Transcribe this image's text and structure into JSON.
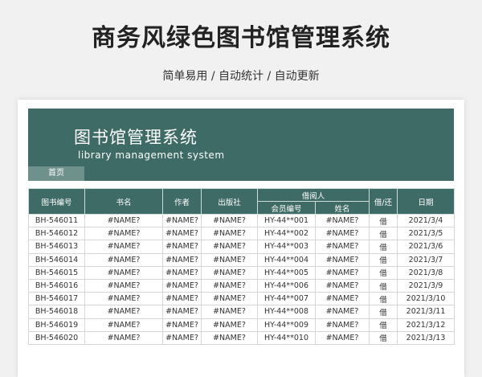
{
  "page": {
    "title": "商务风绿色图书馆管理系统",
    "subtitle": "简单易用 / 自动统计 / 自动更新"
  },
  "banner": {
    "title": "图书馆管理系统",
    "subtitle": "library management system",
    "home_tab": "首页"
  },
  "table": {
    "headers": {
      "book_no": "图书编号",
      "title": "书名",
      "author": "作者",
      "publisher": "出版社",
      "borrower": "借阅人",
      "member_no": "会员编号",
      "name": "姓名",
      "borrow_return": "借/还",
      "date": "日期"
    },
    "rows": [
      [
        "BH-546011",
        "#NAME?",
        "#NAME?",
        "#NAME?",
        "HY-44**001",
        "#NAME?",
        "借",
        "2021/3/4"
      ],
      [
        "BH-546012",
        "#NAME?",
        "#NAME?",
        "#NAME?",
        "HY-44**002",
        "#NAME?",
        "借",
        "2021/3/5"
      ],
      [
        "BH-546013",
        "#NAME?",
        "#NAME?",
        "#NAME?",
        "HY-44**003",
        "#NAME?",
        "借",
        "2021/3/6"
      ],
      [
        "BH-546014",
        "#NAME?",
        "#NAME?",
        "#NAME?",
        "HY-44**004",
        "#NAME?",
        "借",
        "2021/3/7"
      ],
      [
        "BH-546015",
        "#NAME?",
        "#NAME?",
        "#NAME?",
        "HY-44**005",
        "#NAME?",
        "借",
        "2021/3/8"
      ],
      [
        "BH-546016",
        "#NAME?",
        "#NAME?",
        "#NAME?",
        "HY-44**006",
        "#NAME?",
        "借",
        "2021/3/9"
      ],
      [
        "BH-546017",
        "#NAME?",
        "#NAME?",
        "#NAME?",
        "HY-44**007",
        "#NAME?",
        "借",
        "2021/3/10"
      ],
      [
        "BH-546018",
        "#NAME?",
        "#NAME?",
        "#NAME?",
        "HY-44**008",
        "#NAME?",
        "借",
        "2021/3/11"
      ],
      [
        "BH-546019",
        "#NAME?",
        "#NAME?",
        "#NAME?",
        "HY-44**009",
        "#NAME?",
        "借",
        "2021/3/12"
      ],
      [
        "BH-546020",
        "#NAME?",
        "#NAME?",
        "#NAME?",
        "HY-44**010",
        "#NAME?",
        "借",
        "2021/3/13"
      ]
    ]
  },
  "colors": {
    "header_green": "#3f6b66",
    "tab_green": "#6f918c"
  }
}
